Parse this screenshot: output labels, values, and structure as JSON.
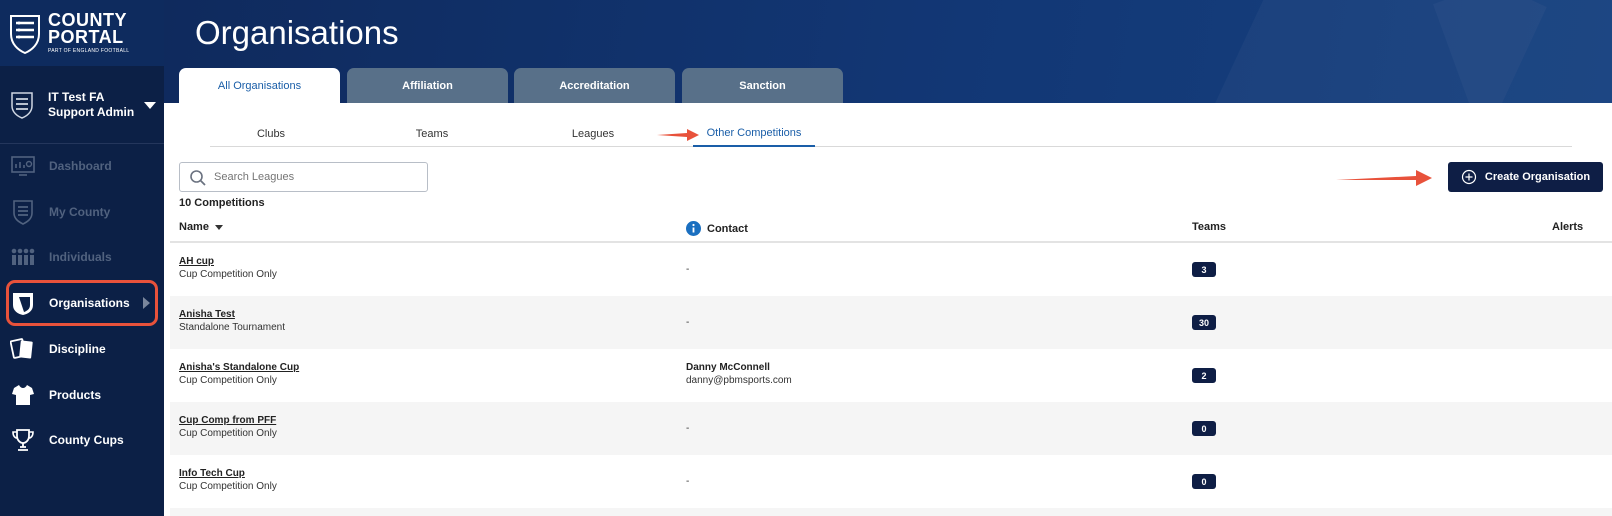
{
  "sidebar": {
    "logo": {
      "line1": "COUNTY",
      "line2": "PORTAL",
      "tagline": "PART OF ENGLAND FOOTBALL"
    },
    "user": {
      "org": "IT Test FA",
      "role": "Support Admin"
    },
    "items": [
      {
        "label": "Dashboard",
        "icon": "dashboard-icon",
        "disabled": true
      },
      {
        "label": "My County",
        "icon": "crest-icon",
        "disabled": true
      },
      {
        "label": "Individuals",
        "icon": "people-icon",
        "disabled": true
      },
      {
        "label": "Organisations",
        "icon": "shield-icon",
        "active": true
      },
      {
        "label": "Discipline",
        "icon": "cards-icon"
      },
      {
        "label": "Products",
        "icon": "shirt-icon"
      },
      {
        "label": "County Cups",
        "icon": "trophy-icon"
      }
    ]
  },
  "header": {
    "title": "Organisations",
    "tabs": [
      "All Organisations",
      "Affiliation",
      "Accreditation",
      "Sanction"
    ],
    "active_tab": "All Organisations"
  },
  "sub_tabs": {
    "items": [
      "Clubs",
      "Teams",
      "Leagues",
      "Other Competitions"
    ],
    "active": "Other Competitions"
  },
  "toolbar": {
    "search_placeholder": "Search Leagues",
    "create_label": "Create Organisation",
    "count_label": "10 Competitions"
  },
  "table": {
    "columns": {
      "name": "Name",
      "contact": "Contact",
      "teams": "Teams",
      "alerts": "Alerts"
    },
    "rows": [
      {
        "name": "AH cup",
        "type": "Cup Competition Only",
        "contact": "-",
        "teams": "3"
      },
      {
        "name": "Anisha Test",
        "type": "Standalone Tournament",
        "contact": "-",
        "teams": "30"
      },
      {
        "name": "Anisha's Standalone Cup",
        "type": "Cup Competition Only",
        "contact_name": "Danny McConnell",
        "contact_email": "danny@pbmsports.com",
        "teams": "2"
      },
      {
        "name": "Cup Comp from PFF",
        "type": "Cup Competition Only",
        "contact": "-",
        "teams": "0"
      },
      {
        "name": "Info Tech Cup",
        "type": "Cup Competition Only",
        "contact": "-",
        "teams": "0"
      }
    ]
  },
  "colors": {
    "sidebar_bg": "#0c2046",
    "header_bg": "#123775",
    "accent_blue": "#1a5ea8",
    "button_navy": "#0e1e45",
    "annotation_red": "#e8523b",
    "tab_inactive": "#587089"
  }
}
